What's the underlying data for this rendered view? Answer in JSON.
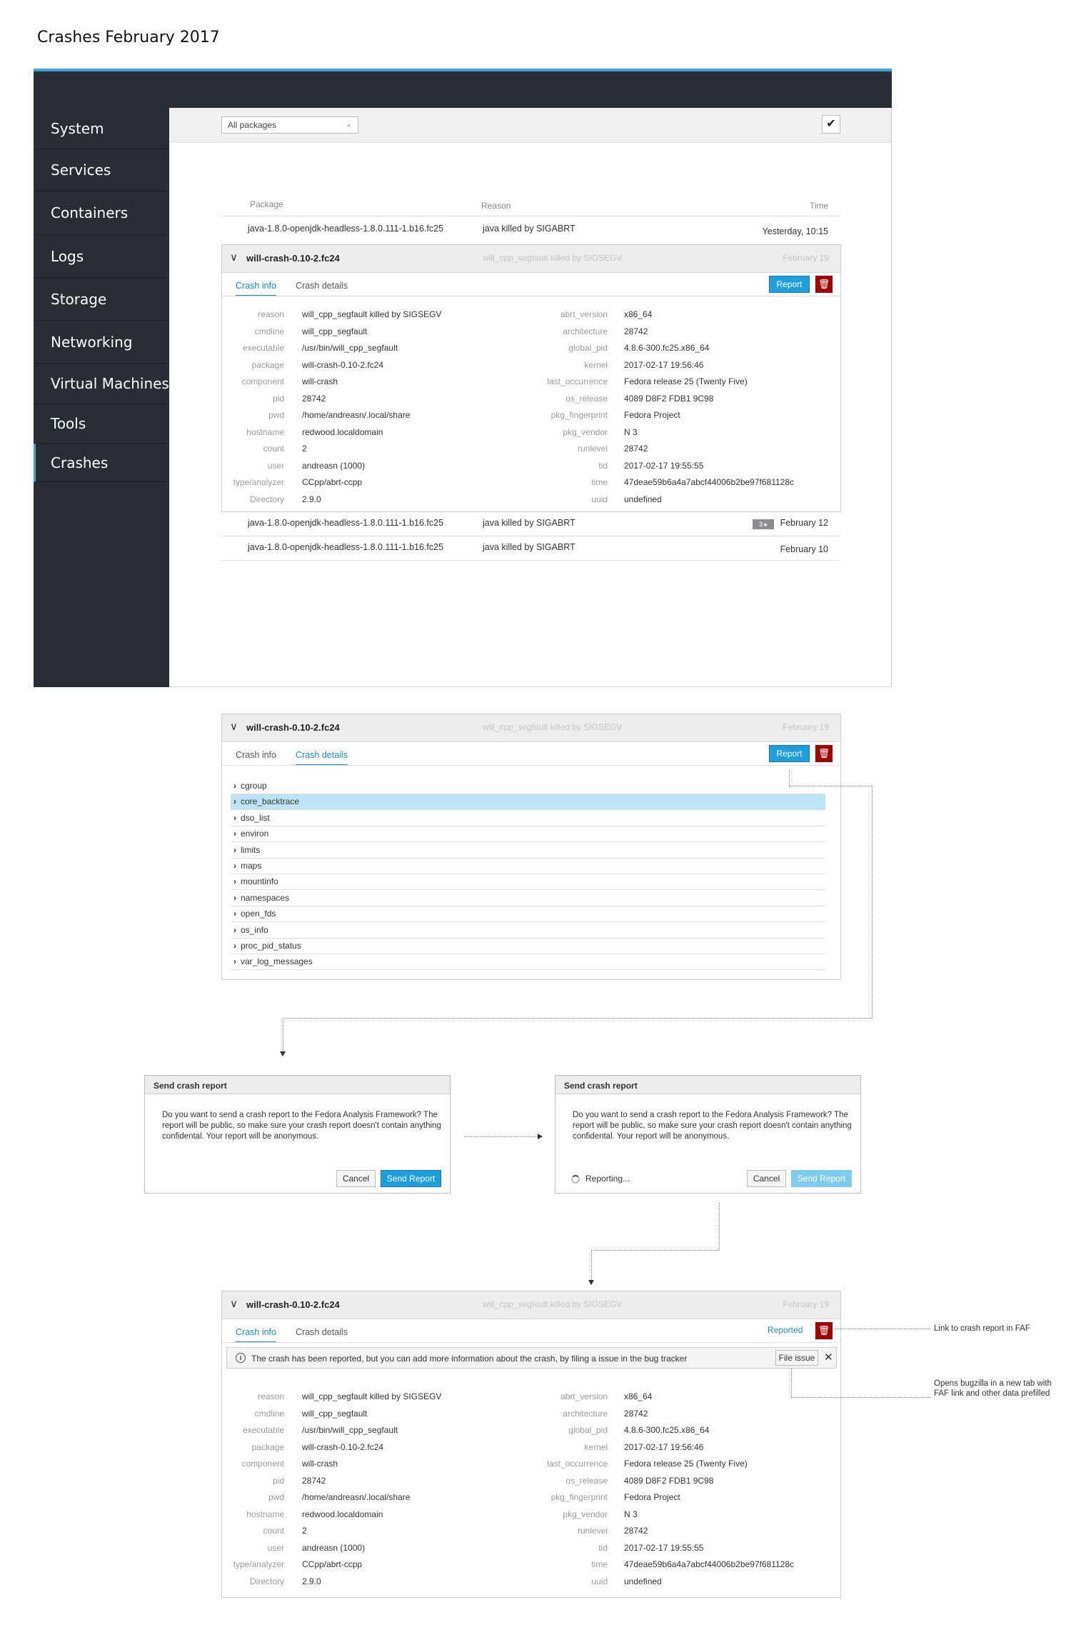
{
  "page_title": "Crashes February 2017",
  "sidebar": {
    "items": [
      {
        "label": "System"
      },
      {
        "label": "Services"
      },
      {
        "label": "Containers"
      },
      {
        "label": "Logs"
      },
      {
        "label": "Storage"
      },
      {
        "label": "Networking"
      },
      {
        "label": "Virtual Machines"
      },
      {
        "label": "Tools"
      },
      {
        "label": "Crashes",
        "active": true
      }
    ]
  },
  "toolbar": {
    "filter_value": "All packages",
    "check_glyph": "✔"
  },
  "table": {
    "headers": {
      "package": "Package",
      "reason": "Reason",
      "time": "Time"
    },
    "rows": [
      {
        "package": "java-1.8.0-openjdk-headless-1.8.0.111-1.b16.fc25",
        "reason": "java killed by SIGABRT",
        "time": "Yesterday, 10:15"
      },
      {
        "package": "java-1.8.0-openjdk-headless-1.8.0.111-1.b16.fc25",
        "reason": "java killed by SIGABRT",
        "time": "February 12",
        "badge": "3 ▸"
      },
      {
        "package": "java-1.8.0-openjdk-headless-1.8.0.111-1.b16.fc25",
        "reason": "java killed by SIGABRT",
        "time": "February 10"
      }
    ]
  },
  "crash": {
    "title": "will-crash-0.10-2.fc24",
    "reason": "will_cpp_segfault killed by SIGSEGV",
    "date": "February 19",
    "tab_info": "Crash info",
    "tab_details": "Crash details",
    "report_label": "Report",
    "reported_label": "Reported",
    "left_fields": [
      {
        "k": "reason",
        "v": "will_cpp_segfault killed by SIGSEGV"
      },
      {
        "k": "cmdline",
        "v": "will_cpp_segfault"
      },
      {
        "k": "executable",
        "v": "/usr/bin/will_cpp_segfault"
      },
      {
        "k": "package",
        "v": "will-crash-0.10-2.fc24"
      },
      {
        "k": "component",
        "v": "will-crash"
      },
      {
        "k": "pid",
        "v": "28742"
      },
      {
        "k": "pwd",
        "v": "/home/andreasn/.local/share"
      },
      {
        "k": "hostname",
        "v": "redwood.localdomain"
      },
      {
        "k": "count",
        "v": "2"
      },
      {
        "k": "user",
        "v": "andreasn (1000)"
      },
      {
        "k": "type/analyzer",
        "v": "CCpp/abrt-ccpp"
      },
      {
        "k": "Directory",
        "v": "2.9.0"
      }
    ],
    "right_fields": [
      {
        "k": "abrt_version",
        "v": "x86_64"
      },
      {
        "k": "architecture",
        "v": "28742"
      },
      {
        "k": "global_pid",
        "v": "4.8.6-300.fc25.x86_64"
      },
      {
        "k": "kernel",
        "v": "2017-02-17 19:56:46"
      },
      {
        "k": "last_occurrence",
        "v": "Fedora release 25 (Twenty Five)"
      },
      {
        "k": "os_release",
        "v": "4089 D8F2 FDB1 9C98"
      },
      {
        "k": "pkg_fingerprint",
        "v": "Fedora Project"
      },
      {
        "k": "pkg_vendor",
        "v": "N 3"
      },
      {
        "k": "runlevel",
        "v": "28742"
      },
      {
        "k": "tid",
        "v": "2017-02-17 19:55:55"
      },
      {
        "k": "time",
        "v": "47deae59b6a4a7abcf44006b2be97f681128c"
      },
      {
        "k": "uuid",
        "v": "undefined"
      }
    ],
    "details_items": [
      "cgroup",
      "core_backtrace",
      "dso_list",
      "environ",
      "limits",
      "maps",
      "mountinfo",
      "namespaces",
      "open_fds",
      "os_info",
      "proc_pid_status",
      "var_log_messages"
    ],
    "alert_text": "The crash has been reported, but you can add more information about the crash, by filing a issue in the bug tracker",
    "file_issue_label": "File issue",
    "close_glyph": "✕"
  },
  "dialog": {
    "title": "Send crash report",
    "body": "Do you want to send a crash report to the Fedora Analysis Framework? The report will be public, so make sure your crash report doesn't contain anything confidental. Your report will be anonymous.",
    "cancel_label": "Cancel",
    "send_label": "Send Report",
    "reporting_label": "Reporting..."
  },
  "annotations": {
    "faf_link": "Link to crash report in FAF",
    "bugzilla": "Opens bugzilla in a new tab with FAF link and other data prefilled"
  },
  "colors": {
    "accent": "#39a5dc",
    "link": "#1a8bc9",
    "danger": "#a30000",
    "chrome": "#292e34"
  }
}
